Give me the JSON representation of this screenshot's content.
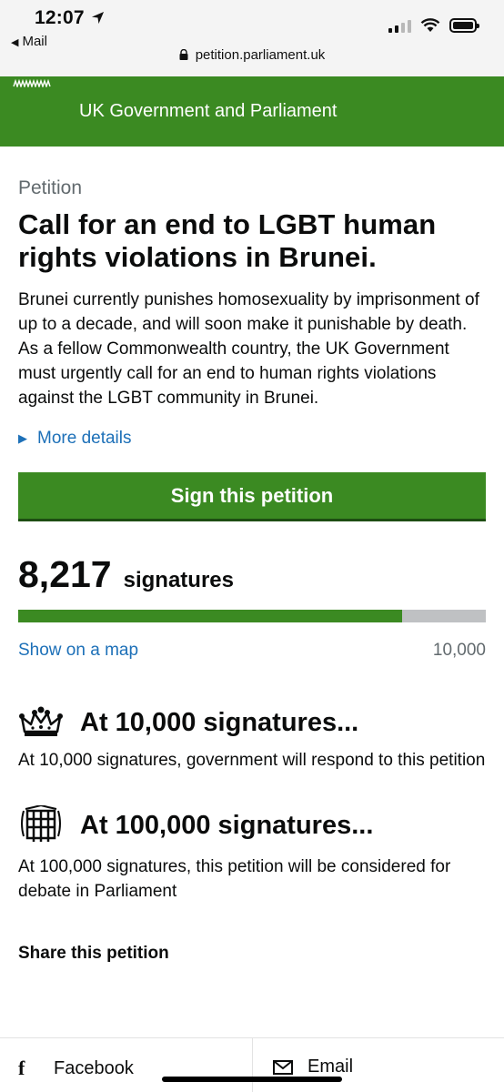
{
  "status_bar": {
    "time": "12:07",
    "back_label": "Mail",
    "url": "petition.parliament.uk"
  },
  "header": {
    "title": "UK Government and Parliament"
  },
  "petition": {
    "caption": "Petition",
    "title": "Call for an end to LGBT human rights violations in Brunei.",
    "description": "Brunei currently punishes homosexuality by imprisonment of up to a decade, and will soon make it punishable by death. As a fellow Commonwealth country, the UK Government must urgently call for an end to human rights violations against the LGBT community in Brunei.",
    "more_details": "More details",
    "sign_button": "Sign this petition"
  },
  "signatures": {
    "count": "8,217",
    "label": "signatures",
    "progress_fraction": 0.8217,
    "map_link": "Show on a map",
    "target": "10,000"
  },
  "milestones": [
    {
      "icon": "crown-icon",
      "heading": "At 10,000 signatures...",
      "text": "At 10,000 signatures, government will respond to this petition"
    },
    {
      "icon": "portcullis-icon",
      "heading": "At 100,000 signatures...",
      "text": "At 100,000 signatures, this petition will be considered for debate in Parliament"
    }
  ],
  "share": {
    "heading": "Share this petition",
    "facebook": "Facebook",
    "email": "Email"
  },
  "colors": {
    "accent_green": "#3b8a22",
    "link_blue": "#1d70b8"
  }
}
